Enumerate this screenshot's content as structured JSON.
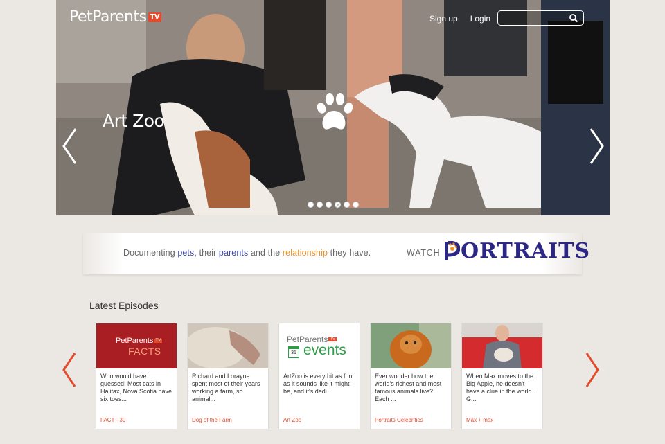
{
  "brand": {
    "name": "PetParents",
    "tv": "TV"
  },
  "nav": {
    "signup": "Sign up",
    "login": "Login"
  },
  "search": {
    "placeholder": ""
  },
  "hero": {
    "title": "Art Zoo",
    "slides": 6,
    "active_slide": 4
  },
  "banner": {
    "t1": "Documenting ",
    "t2": "pets",
    "t3": ", their ",
    "t4": "parents",
    "t5": " and the ",
    "t6": "relationship",
    "t7": " they have.",
    "watch": "WATCH",
    "portraits": "ORTRAITS"
  },
  "section": {
    "title": "Latest Episodes"
  },
  "cards": [
    {
      "text": "Who would have guessed! Most cats in Halifax, Nova Scotia have six toes...",
      "category": "FACT - 30",
      "thumb_brand": "PetParents",
      "thumb_tv": "TV",
      "thumb_label": "FACTS"
    },
    {
      "text": "Richard and Lorayne spent most of their years working a farm, so animal...",
      "category": "Dog of the Farm"
    },
    {
      "text": "ArtZoo is every bit as fun as it sounds like it might be, and it's dedi...",
      "category": "Art Zoo",
      "thumb_brand": "PetParents",
      "thumb_tv": "TV",
      "thumb_label": "events",
      "thumb_day": "31"
    },
    {
      "text": "Ever wonder how the world's richest and most famous animals live? Each ...",
      "category": "Portraits Celebrities"
    },
    {
      "text": "When Max moves to the Big Apple, he doesn't have a clue in the world. G...",
      "category": "Max + max"
    }
  ],
  "colors": {
    "accent": "#e44b2c",
    "blue": "#3b4aa8",
    "orange": "#f0922b",
    "navy": "#2c2785",
    "background": "#ebe8e3"
  }
}
